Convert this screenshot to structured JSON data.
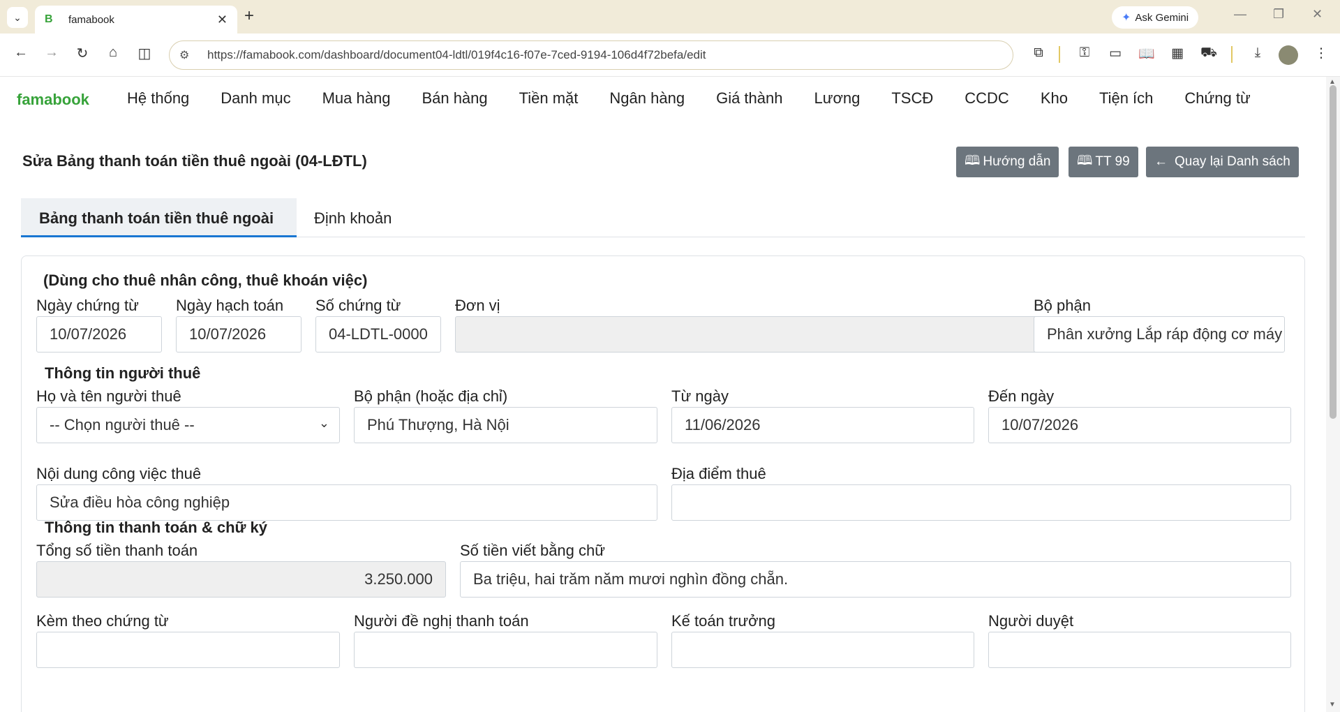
{
  "browser": {
    "tab_title": "famabook",
    "tab_favicon": "B",
    "gemini_label": "Ask Gemini",
    "url": "https://famabook.com/dashboard/document04-ldtl/019f4c16-f07e-7ced-9194-106d4f72befa/edit"
  },
  "app": {
    "brand": "famabook",
    "brand_color": "#37a33a",
    "nav": [
      "Hệ thống",
      "Danh mục",
      "Mua hàng",
      "Bán hàng",
      "Tiền mặt",
      "Ngân hàng",
      "Giá thành",
      "Lương",
      "TSCĐ",
      "CCDC",
      "Kho",
      "Tiện ích",
      "Chứng từ"
    ]
  },
  "page": {
    "title": "Sửa Bảng thanh toán tiền thuê ngoài (04-LĐTL)",
    "btn_guide": "Hướng dẫn",
    "btn_tt": "TT 99",
    "btn_back": "Quay lại Danh sách",
    "tab_main": "Bảng thanh toán tiền thuê ngoài",
    "tab_entries": "Định khoản"
  },
  "form": {
    "subtitle": "(Dùng cho thuê nhân công, thuê khoán việc)",
    "doc_date_label": "Ngày chứng từ",
    "doc_date": "10/07/2026",
    "post_date_label": "Ngày hạch toán",
    "post_date": "10/07/2026",
    "doc_no_label": "Số chứng từ",
    "doc_no": "04-LDTL-0000",
    "unit_label": "Đơn vị",
    "unit": "",
    "dept_label": "Bộ phận",
    "dept": "Phân xưởng Lắp ráp động cơ máy",
    "hirer_section": "Thông tin người thuê",
    "hirer_name_label": "Họ và tên người thuê",
    "hirer_name": "-- Chọn người thuê --",
    "hirer_dept_label": "Bộ phận (hoặc địa chỉ)",
    "hirer_dept": "Phú Thượng, Hà Nội",
    "from_label": "Từ ngày",
    "from": "11/06/2026",
    "to_label": "Đến ngày",
    "to": "10/07/2026",
    "work_label": "Nội dung công việc thuê",
    "work": "Sửa điều hòa công nghiệp",
    "place_label": "Địa điểm thuê",
    "place": "",
    "pay_section": "Thông tin thanh toán & chữ ký",
    "total_label": "Tổng số tiền thanh toán",
    "total": "3.250.000",
    "words_label": "Số tiền viết bằng chữ",
    "words": "Ba triệu, hai trăm năm mươi nghìn đồng chẵn.",
    "attach_label": "Kèm theo chứng từ",
    "requester_label": "Người đề nghị thanh toán",
    "chief_label": "Kế toán trưởng",
    "approver_label": "Người duyệt"
  },
  "colors": {
    "accent": "#1976d2",
    "button": "#6c757d"
  }
}
